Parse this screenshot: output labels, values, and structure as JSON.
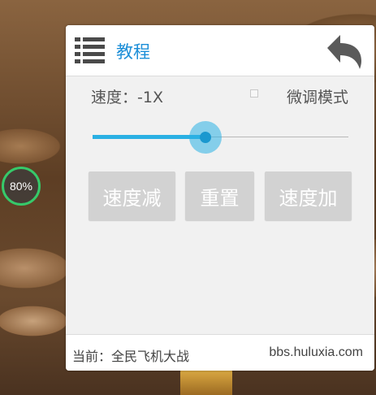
{
  "overlay": {
    "progress_label": "80%"
  },
  "panel": {
    "title": "教程",
    "speed_label": "速度：-1X",
    "fine_mode_label": "微调模式",
    "fine_mode_checked": false,
    "slider_value": 0.44,
    "buttons": {
      "decrease": "速度减",
      "reset": "重置",
      "increase": "速度加"
    },
    "footer": {
      "current": "当前：全民飞机大战",
      "site": "bbs.huluxia.com"
    }
  },
  "colors": {
    "accent": "#1d8fd8",
    "slider": "#2ab0e3",
    "button_bg": "#d2d2d2",
    "progress_ring": "#36c96a"
  }
}
